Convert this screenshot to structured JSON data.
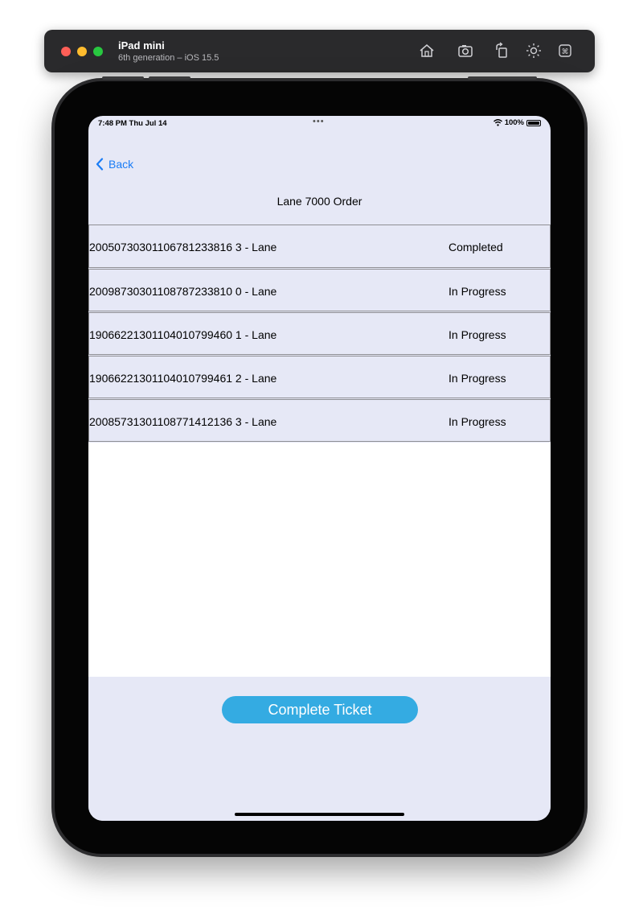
{
  "simulator": {
    "device_name": "iPad mini",
    "device_subtitle": "6th generation – iOS 15.5",
    "tools": [
      "home-icon",
      "screenshot-icon",
      "rotate-icon",
      "appearance-icon",
      "keyboard-icon"
    ]
  },
  "status_bar": {
    "time": "7:48 PM  Thu Jul 14",
    "dots": "•••",
    "battery": "100%"
  },
  "nav": {
    "back_label": "Back",
    "title": "Lane 7000 Order"
  },
  "orders": [
    {
      "id": "20050730301106781233816 3 - Lane",
      "status": "Completed"
    },
    {
      "id": "20098730301108787233810 0 - Lane",
      "status": "In Progress"
    },
    {
      "id": "19066221301104010799460 1 - Lane",
      "status": "In Progress"
    },
    {
      "id": "19066221301104010799461 2 - Lane",
      "status": "In Progress"
    },
    {
      "id": "20085731301108771412136 3 - Lane",
      "status": "In Progress"
    }
  ],
  "actions": {
    "complete_label": "Complete Ticket"
  },
  "colors": {
    "screen_bg": "#e6e8f6",
    "accent_blue": "#1a7cf5",
    "button_bg": "#34abe2"
  }
}
